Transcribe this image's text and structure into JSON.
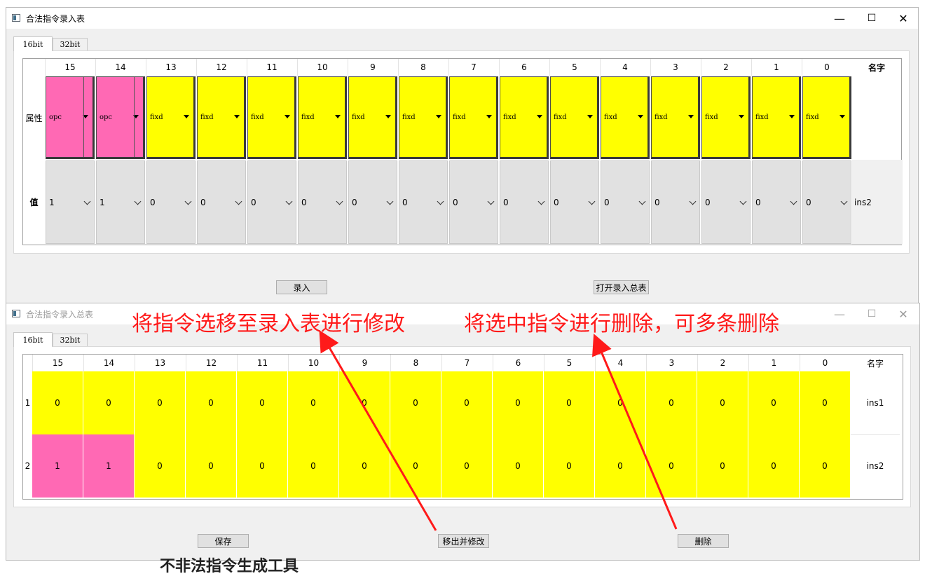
{
  "entry_window": {
    "title": "合法指令录入表",
    "tabs": [
      "16bit",
      "32bit"
    ],
    "bit_headers": [
      "15",
      "14",
      "13",
      "12",
      "11",
      "10",
      "9",
      "8",
      "7",
      "6",
      "5",
      "4",
      "3",
      "2",
      "1",
      "0"
    ],
    "name_header": "名字",
    "row_labels": {
      "attr": "属性",
      "value": "值"
    },
    "attributes": [
      "opc",
      "opc",
      "fixd",
      "fixd",
      "fixd",
      "fixd",
      "fixd",
      "fixd",
      "fixd",
      "fixd",
      "fixd",
      "fixd",
      "fixd",
      "fixd",
      "fixd",
      "fixd"
    ],
    "values": [
      "1",
      "1",
      "0",
      "0",
      "0",
      "0",
      "0",
      "0",
      "0",
      "0",
      "0",
      "0",
      "0",
      "0",
      "0",
      "0"
    ],
    "name_value": "ins2",
    "submit_button": "录入",
    "open_summary_button": "打开录入总表",
    "window_buttons": {
      "minimize": "—",
      "maximize": "☐",
      "close": "✕"
    }
  },
  "summary_window": {
    "title": "合法指令录入总表",
    "tabs": [
      "16bit",
      "32bit"
    ],
    "bit_headers": [
      "15",
      "14",
      "13",
      "12",
      "11",
      "10",
      "9",
      "8",
      "7",
      "6",
      "5",
      "4",
      "3",
      "2",
      "1",
      "0"
    ],
    "name_header": "名字",
    "rows": [
      {
        "index": "1",
        "cells": [
          "0",
          "0",
          "0",
          "0",
          "0",
          "0",
          "0",
          "0",
          "0",
          "0",
          "0",
          "0",
          "0",
          "0",
          "0",
          "0"
        ],
        "name": "ins1"
      },
      {
        "index": "2",
        "cells": [
          "1",
          "1",
          "0",
          "0",
          "0",
          "0",
          "0",
          "0",
          "0",
          "0",
          "0",
          "0",
          "0",
          "0",
          "0",
          "0"
        ],
        "name": "ins2"
      }
    ],
    "save_button": "保存",
    "move_edit_button": "移出并修改",
    "delete_button": "删除",
    "window_buttons": {
      "minimize": "—",
      "maximize": "☐",
      "close": "✕"
    }
  },
  "annotations": {
    "move_note": "将指令选移至录入表进行修改",
    "delete_note": "将选中指令进行删除，可多条删除"
  },
  "background_text": "不非法指令生成工具",
  "colors": {
    "opc": "#ff69b4",
    "fixd": "#ffff00",
    "annotation": "#ff1a1a"
  }
}
